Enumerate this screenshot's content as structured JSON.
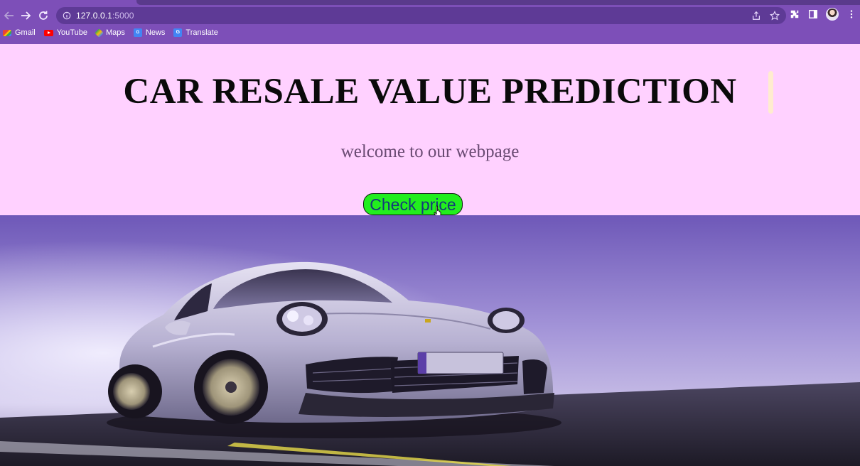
{
  "browser": {
    "url_host": "127.0.0.1",
    "url_port": ":5000",
    "bookmarks": [
      {
        "label": "Gmail",
        "icon": "gmail-icon"
      },
      {
        "label": "YouTube",
        "icon": "youtube-icon"
      },
      {
        "label": "Maps",
        "icon": "maps-icon"
      },
      {
        "label": "News",
        "icon": "news-icon"
      },
      {
        "label": "Translate",
        "icon": "translate-icon"
      }
    ],
    "accent_color": "#7d4fb8"
  },
  "page": {
    "title": "CAR RESALE VALUE PREDICTION",
    "subtitle": "welcome to our webpage",
    "cta_label": "Check price",
    "background_color": "#ffd1ff",
    "cta_color": "#22ee1e"
  },
  "banner": {
    "image": "silver-sports-car-on-road"
  }
}
